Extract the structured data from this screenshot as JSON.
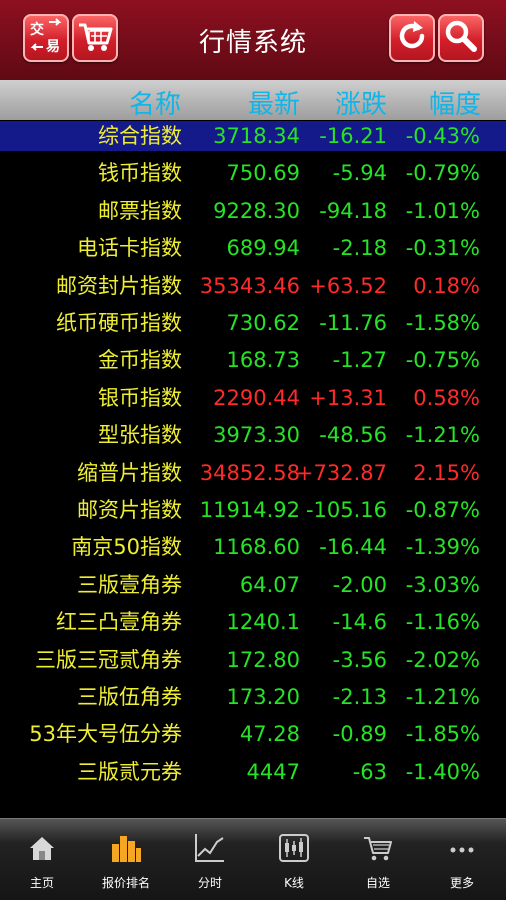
{
  "header": {
    "title": "行情系统",
    "left_icons": [
      "trade-icon",
      "cart-icon"
    ],
    "right_icons": [
      "refresh-icon",
      "search-icon"
    ]
  },
  "columns": {
    "name": "名称",
    "latest": "最新",
    "change": "涨跌",
    "percent": "幅度"
  },
  "rows": [
    {
      "name": "综合指数",
      "latest": "3718.34",
      "change": "-16.21",
      "percent": "-0.43%",
      "dir": "down",
      "selected": true
    },
    {
      "name": "钱币指数",
      "latest": "750.69",
      "change": "-5.94",
      "percent": "-0.79%",
      "dir": "down"
    },
    {
      "name": "邮票指数",
      "latest": "9228.30",
      "change": "-94.18",
      "percent": "-1.01%",
      "dir": "down"
    },
    {
      "name": "电话卡指数",
      "latest": "689.94",
      "change": "-2.18",
      "percent": "-0.31%",
      "dir": "down"
    },
    {
      "name": "邮资封片指数",
      "latest": "35343.46",
      "change": "+63.52",
      "percent": "0.18%",
      "dir": "up"
    },
    {
      "name": "纸币硬币指数",
      "latest": "730.62",
      "change": "-11.76",
      "percent": "-1.58%",
      "dir": "down"
    },
    {
      "name": "金币指数",
      "latest": "168.73",
      "change": "-1.27",
      "percent": "-0.75%",
      "dir": "down"
    },
    {
      "name": "银币指数",
      "latest": "2290.44",
      "change": "+13.31",
      "percent": "0.58%",
      "dir": "up"
    },
    {
      "name": "型张指数",
      "latest": "3973.30",
      "change": "-48.56",
      "percent": "-1.21%",
      "dir": "down"
    },
    {
      "name": "缩普片指数",
      "latest": "34852.58",
      "change": "+732.87",
      "percent": "2.15%",
      "dir": "up"
    },
    {
      "name": "邮资片指数",
      "latest": "11914.92",
      "change": "-105.16",
      "percent": "-0.87%",
      "dir": "down"
    },
    {
      "name": "南京50指数",
      "latest": "1168.60",
      "change": "-16.44",
      "percent": "-1.39%",
      "dir": "down"
    },
    {
      "name": "三版壹角券",
      "latest": "64.07",
      "change": "-2.00",
      "percent": "-3.03%",
      "dir": "down"
    },
    {
      "name": "红三凸壹角券",
      "latest": "1240.1",
      "change": "-14.6",
      "percent": "-1.16%",
      "dir": "down"
    },
    {
      "name": "三版三冠贰角券",
      "latest": "172.80",
      "change": "-3.56",
      "percent": "-2.02%",
      "dir": "down"
    },
    {
      "name": "三版伍角券",
      "latest": "173.20",
      "change": "-2.13",
      "percent": "-1.21%",
      "dir": "down"
    },
    {
      "name": "53年大号伍分券",
      "latest": "47.28",
      "change": "-0.89",
      "percent": "-1.85%",
      "dir": "down"
    },
    {
      "name": "三版贰元券",
      "latest": "4447",
      "change": "-63",
      "percent": "-1.40%",
      "dir": "down"
    }
  ],
  "tabs": [
    {
      "label": "主页",
      "icon": "home-icon"
    },
    {
      "label": "报价排名",
      "icon": "bar-chart-icon",
      "active": true
    },
    {
      "label": "分时",
      "icon": "line-chart-icon"
    },
    {
      "label": "K线",
      "icon": "candlestick-icon"
    },
    {
      "label": "自选",
      "icon": "cart-icon"
    },
    {
      "label": "更多",
      "icon": "more-icon"
    }
  ],
  "colors": {
    "header_bg": "#8e1020",
    "column_header_text": "#11b5e8",
    "name_text": "#eeee33",
    "up": "#ff2a2a",
    "down": "#27e327",
    "selected_row_bg": "#141a8a",
    "active_tab": "#f5a623"
  }
}
